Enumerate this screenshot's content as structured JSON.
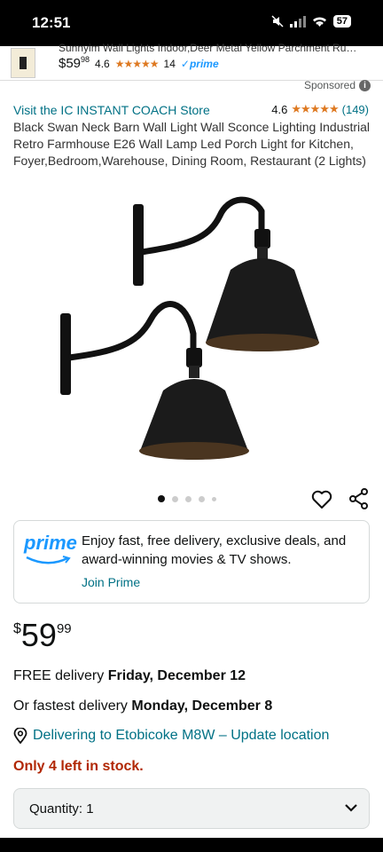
{
  "status": {
    "time": "12:51",
    "battery": "57"
  },
  "sticky": {
    "title": "Sunnyim Wall Lights Indoor,Deer Metal Yellow Parchment Rust...",
    "price_whole": "$59",
    "price_fraction": "98",
    "rating": "4.6",
    "stars": "★★★★★",
    "review_count": "14",
    "prime": "✓prime"
  },
  "sponsored": "Sponsored",
  "store_link": "Visit the IC INSTANT COACH Store",
  "rating": {
    "value": "4.6",
    "stars": "★★★★★",
    "count": "(149)"
  },
  "product_title": "Black Swan Neck Barn Wall Light Wall Sconce Lighting Industrial Retro Farmhouse E26 Wall Lamp Led Porch Light for Kitchen, Foyer,Bedroom,Warehouse, Dining Room, Restaurant (2 Lights)",
  "prime_box": {
    "logo": "prime",
    "text": "Enjoy fast, free delivery, exclusive deals, and award-winning movies & TV shows.",
    "link": "Join Prime"
  },
  "price": {
    "symbol": "$",
    "whole": "59",
    "fraction": "99"
  },
  "delivery": {
    "free_prefix": "FREE delivery ",
    "free_date": "Friday, December 12",
    "fast_prefix": "Or fastest delivery ",
    "fast_date": "Monday, December 8"
  },
  "deliver_to": "Delivering to Etobicoke M8W – Update location",
  "stock": "Only 4 left in stock.",
  "quantity": {
    "label": "Quantity:",
    "value": "1"
  },
  "colors": {
    "link": "#007185",
    "stock": "#b12704",
    "star": "#de7921",
    "prime": "#1a98ff"
  }
}
